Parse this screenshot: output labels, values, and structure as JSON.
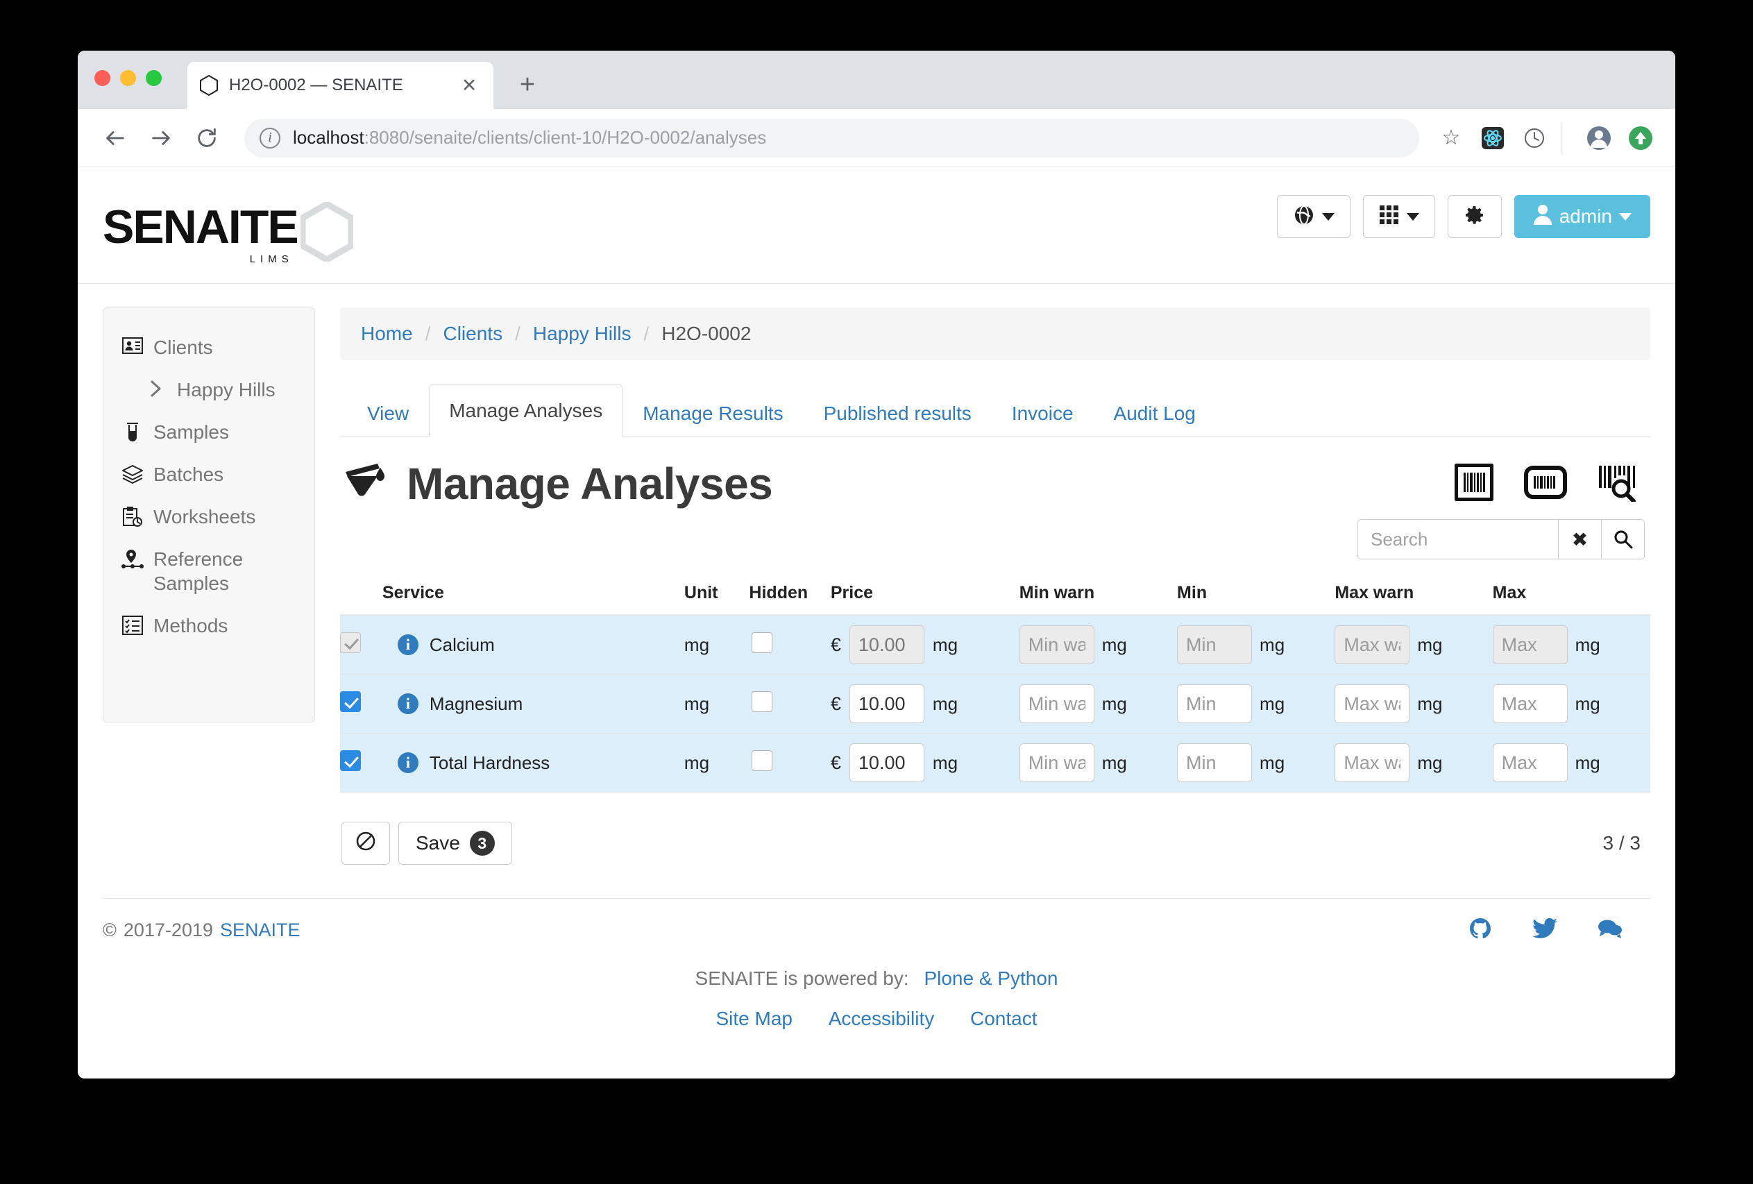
{
  "browser": {
    "tab_title": "H2O-0002 — SENAITE",
    "url_host": "localhost",
    "url_rest": ":8080/senaite/clients/client-10/H2O-0002/analyses"
  },
  "header": {
    "logo_word": "SENAITE",
    "logo_sub": "LIMS",
    "actions": {
      "language_label": "",
      "apps_label": "",
      "settings_label": "",
      "user_label": "admin"
    }
  },
  "sidebar": {
    "items": [
      {
        "label": "Clients",
        "icon": "id-card-icon"
      },
      {
        "label": "Happy Hills",
        "icon": "chevron-right-icon"
      },
      {
        "label": "Samples",
        "icon": "test-tube-icon"
      },
      {
        "label": "Batches",
        "icon": "layers-icon"
      },
      {
        "label": "Worksheets",
        "icon": "clipboard-clock-icon"
      },
      {
        "label": "Reference Samples",
        "icon": "map-pin-icon"
      },
      {
        "label": "Methods",
        "icon": "checklist-icon"
      }
    ]
  },
  "breadcrumb": {
    "items": [
      "Home",
      "Clients",
      "Happy Hills"
    ],
    "current": "H2O-0002"
  },
  "tabs": [
    {
      "label": "View",
      "active": false
    },
    {
      "label": "Manage Analyses",
      "active": true
    },
    {
      "label": "Manage Results",
      "active": false
    },
    {
      "label": "Published results",
      "active": false
    },
    {
      "label": "Invoice",
      "active": false
    },
    {
      "label": "Audit Log",
      "active": false
    }
  ],
  "main": {
    "title": "Manage Analyses",
    "title_icon": "flask-icon",
    "barcode_icons": [
      "barcode-icon",
      "barcode-rounded-icon",
      "barcode-scan-icon"
    ],
    "search": {
      "placeholder": "Search",
      "value": "",
      "clear_icon": "close-icon",
      "submit_icon": "search-icon"
    },
    "table": {
      "columns": [
        "Service",
        "Unit",
        "Hidden",
        "Price",
        "Min warn",
        "Min",
        "Max warn",
        "Max"
      ],
      "rows": [
        {
          "selected": true,
          "disabled": true,
          "service": "Calcium",
          "unit": "mg",
          "hidden": false,
          "currency": "€",
          "price": "10.00",
          "price_unit": "mg",
          "min_warn": "",
          "min_warn_ph": "Min warn",
          "min": "",
          "min_ph": "Min",
          "max_warn": "",
          "max_warn_ph": "Max warn",
          "max": "",
          "max_ph": "Max",
          "range_unit": "mg"
        },
        {
          "selected": true,
          "disabled": false,
          "service": "Magnesium",
          "unit": "mg",
          "hidden": false,
          "currency": "€",
          "price": "10.00",
          "price_unit": "mg",
          "min_warn": "",
          "min_warn_ph": "Min warn",
          "min": "",
          "min_ph": "Min",
          "max_warn": "",
          "max_warn_ph": "Max warn",
          "max": "",
          "max_ph": "Max",
          "range_unit": "mg"
        },
        {
          "selected": true,
          "disabled": false,
          "service": "Total Hardness",
          "unit": "mg",
          "hidden": false,
          "currency": "€",
          "price": "10.00",
          "price_unit": "mg",
          "min_warn": "",
          "min_warn_ph": "Min warn",
          "min": "",
          "min_ph": "Min",
          "max_warn": "",
          "max_warn_ph": "Max warn",
          "max": "",
          "max_ph": "Max",
          "range_unit": "mg"
        }
      ]
    },
    "actions": {
      "deselect_icon": "no-entry-icon",
      "save_label": "Save",
      "save_count": "3"
    },
    "count": "3 / 3"
  },
  "footer": {
    "copyright_symbol": "©",
    "copyright_years": "2017-2019",
    "copyright_link": "SENAITE",
    "socials": [
      "github-icon",
      "twitter-icon",
      "chat-icon"
    ],
    "powered_by_text": "SENAITE is powered by:",
    "powered_by_link": "Plone & Python",
    "links": [
      "Site Map",
      "Accessibility",
      "Contact"
    ]
  }
}
